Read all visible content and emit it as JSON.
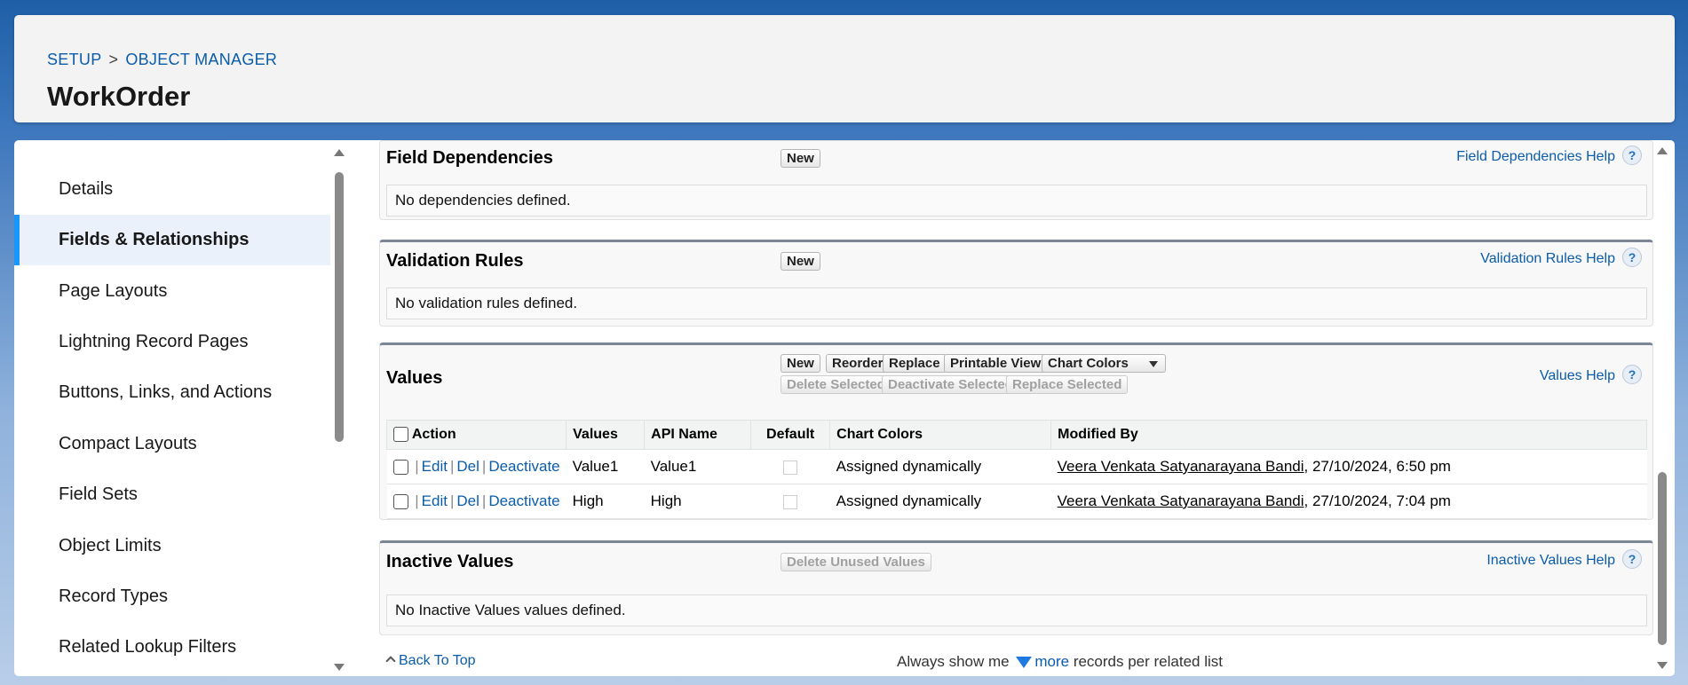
{
  "header": {
    "breadcrumb": [
      "SETUP",
      ">",
      "OBJECT MANAGER"
    ],
    "title": "WorkOrder"
  },
  "sidebar": {
    "items": [
      {
        "label": "Details"
      },
      {
        "label": "Fields & Relationships"
      },
      {
        "label": "Page Layouts"
      },
      {
        "label": "Lightning Record Pages"
      },
      {
        "label": "Buttons, Links, and Actions"
      },
      {
        "label": "Compact Layouts"
      },
      {
        "label": "Field Sets"
      },
      {
        "label": "Object Limits"
      },
      {
        "label": "Record Types"
      },
      {
        "label": "Related Lookup Filters"
      }
    ],
    "active_index": 1
  },
  "sections": {
    "field_dependencies": {
      "title": "Field Dependencies",
      "new_label": "New",
      "help": "Field Dependencies Help",
      "message": "No dependencies defined."
    },
    "validation_rules": {
      "title": "Validation Rules",
      "new_label": "New",
      "help": "Validation Rules Help",
      "message": "No validation rules defined."
    },
    "values": {
      "title": "Values",
      "buttons": {
        "new": "New",
        "reorder": "Reorder",
        "replace": "Replace",
        "printable_view": "Printable View",
        "chart_colors": "Chart Colors",
        "delete_selected": "Delete Selected",
        "deactivate_selected": "Deactivate Selected",
        "replace_selected": "Replace Selected"
      },
      "help": "Values Help",
      "columns": [
        "Action",
        "Values",
        "API Name",
        "Default",
        "Chart Colors",
        "Modified By"
      ],
      "row_actions": {
        "edit": "Edit",
        "del": "Del",
        "deactivate": "Deactivate",
        "sep": "|"
      },
      "rows": [
        {
          "value": "Value1",
          "api_name": "Value1",
          "chart_colors": "Assigned dynamically",
          "modified_by": "Veera Venkata Satyanarayana Bandi",
          "modified_date": ", 27/10/2024, 6:50 pm"
        },
        {
          "value": "High",
          "api_name": "High",
          "chart_colors": "Assigned dynamically",
          "modified_by": "Veera Venkata Satyanarayana Bandi",
          "modified_date": ", 27/10/2024, 7:04 pm"
        }
      ]
    },
    "inactive_values": {
      "title": "Inactive Values",
      "delete_unused_label": "Delete Unused Values",
      "help": "Inactive Values Help",
      "message": "No Inactive Values values defined."
    }
  },
  "footer": {
    "back_to_top": "Back To Top",
    "always_show_prefix": "Always show me",
    "more_label": "more",
    "suffix": "records per related list"
  },
  "icons": {
    "help": "question-mark-icon",
    "dropdown": "chevron-down-icon",
    "back": "chevron-up-icon",
    "more": "triangle-down-icon"
  },
  "colors": {
    "link": "#0b5cab",
    "active_nav_bg": "#eaf1fb",
    "active_nav_bar": "#1b96ff"
  }
}
